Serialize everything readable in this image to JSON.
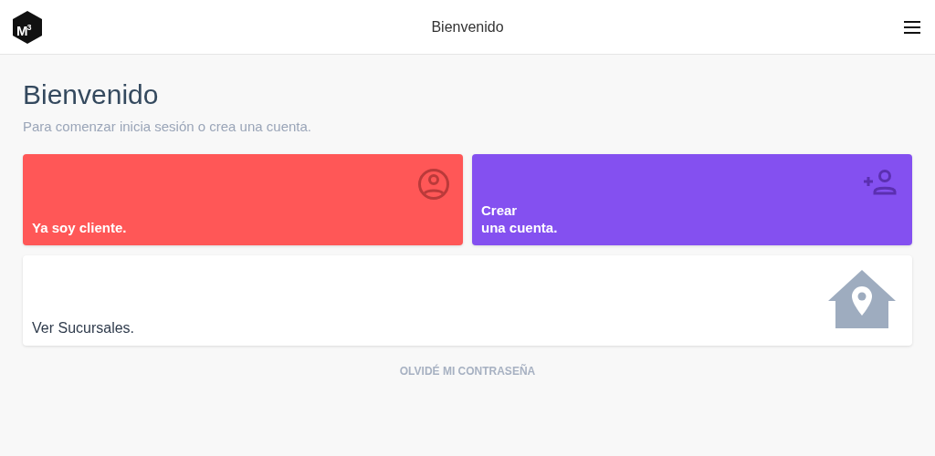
{
  "header": {
    "logo": "M$^{3}$",
    "title": "Bienvenido"
  },
  "heading": "Bienvenido",
  "subtitle": "Para comenzar inicia sesión o crea una cuenta.",
  "cards": [
    {
      "kind": "login",
      "color": "#ff5757",
      "lines": [
        "Ya soy cliente."
      ]
    },
    {
      "kind": "signup",
      "color": "#8450f0",
      "lines": [
        "Crear",
        "una cuenta."
      ]
    },
    {
      "kind": "branches",
      "color": "#ffffff",
      "lines": [
        "Ver Sucursales."
      ]
    }
  ],
  "forgot_link": "OLVIDÉ MI CONTRASEÑA"
}
